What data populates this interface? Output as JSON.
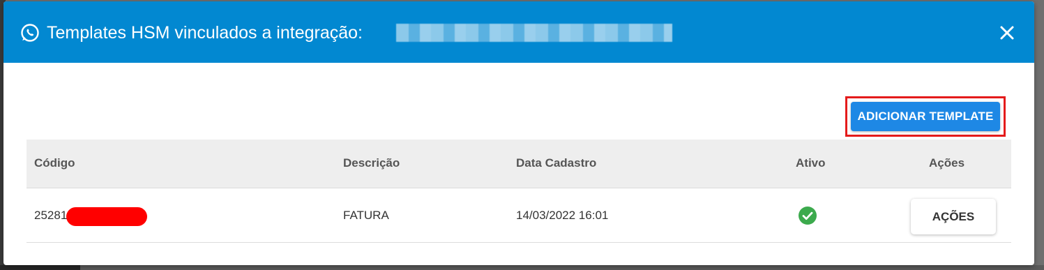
{
  "modal": {
    "title": "Templates HSM vinculados a integração:",
    "header_color": "#0288d1",
    "close_icon": "close-icon",
    "title_icon": "whatsapp-icon"
  },
  "toolbar": {
    "add_template_label": "ADICIONAR TEMPLATE",
    "accent_color": "#1e88e5"
  },
  "table": {
    "columns": [
      "Código",
      "Descrição",
      "Data Cadastro",
      "Ativo",
      "Ações"
    ],
    "rows": [
      {
        "codigo": "25281",
        "descricao": "FATURA",
        "data_cadastro": "14/03/2022 16:01",
        "ativo": "check-circle-icon",
        "acoes_label": "AÇÕES"
      }
    ]
  },
  "status_color": "#3caa4d"
}
